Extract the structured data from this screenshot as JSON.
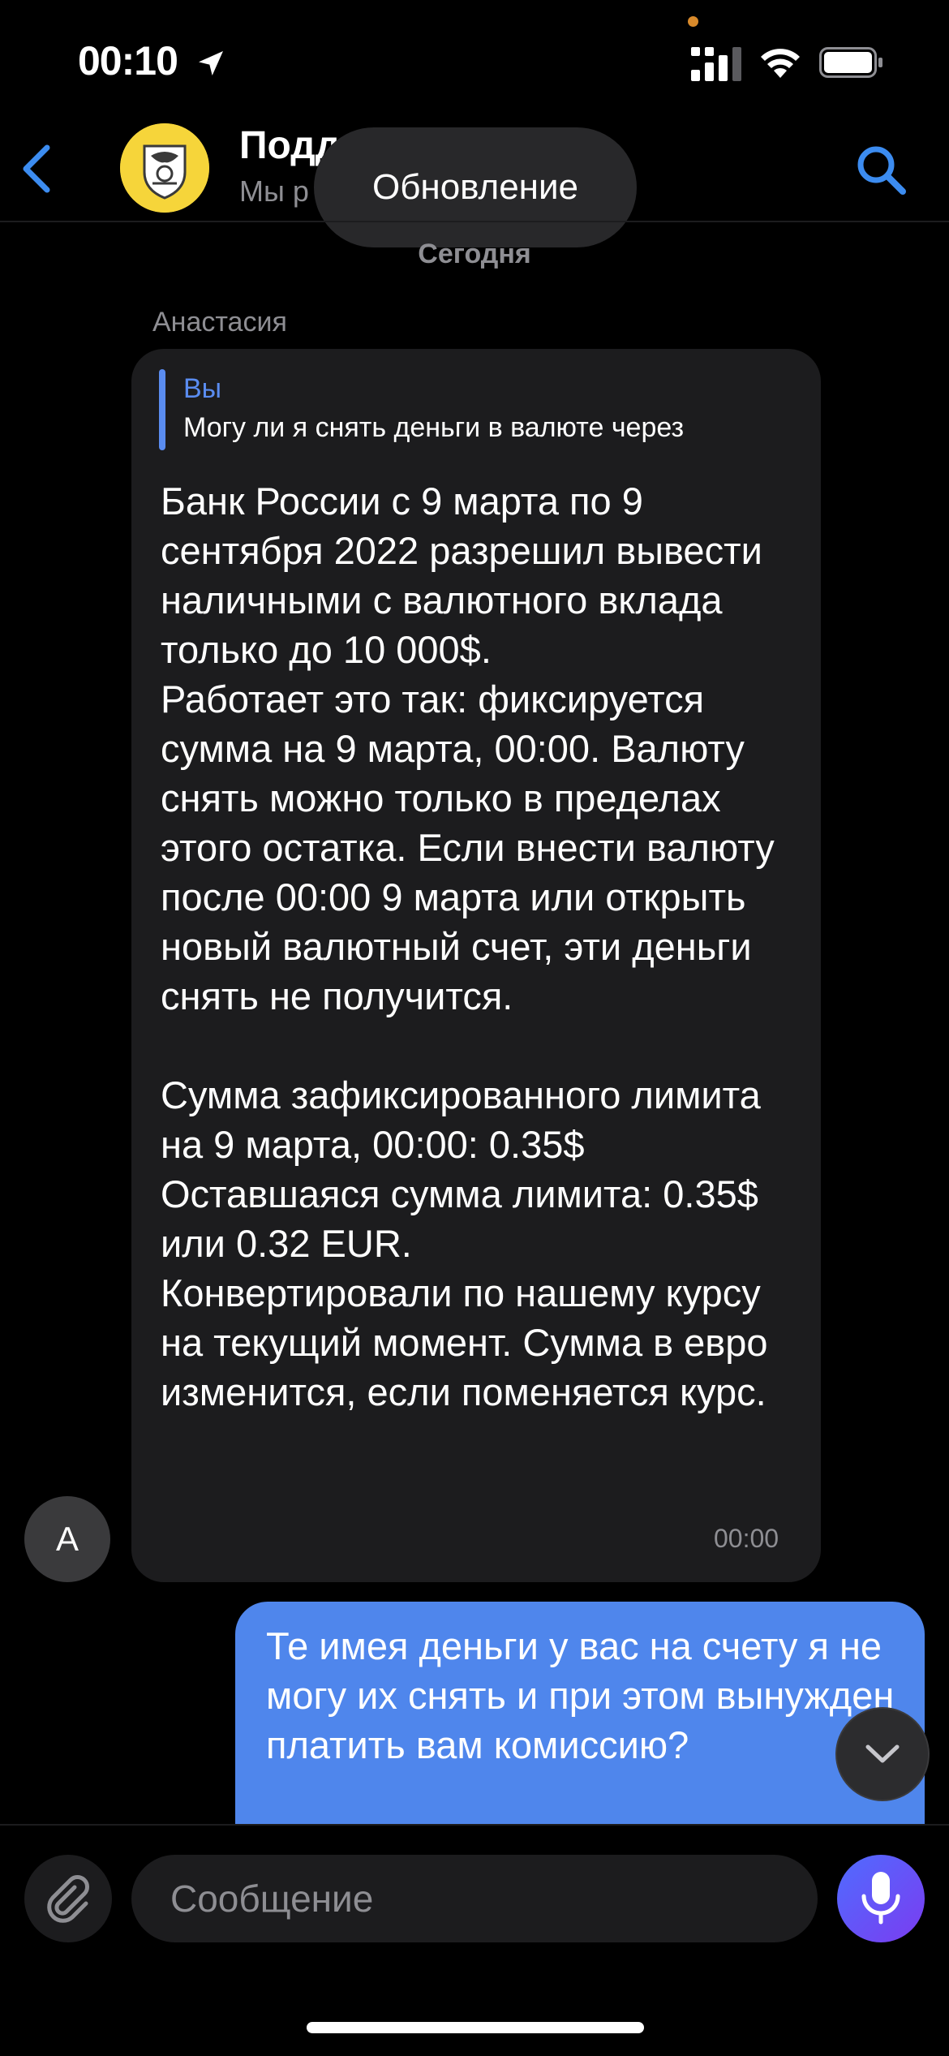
{
  "status_bar": {
    "time": "00:10"
  },
  "header": {
    "title": "Подд",
    "subtitle": "Мы р",
    "toast": "Обновление"
  },
  "chat": {
    "date_separator": "Сегодня",
    "incoming": {
      "sender": "Анастасия",
      "avatar_letter": "А",
      "reply_to": {
        "author": "Вы",
        "text": "Могу ли я снять деньги в валюте через"
      },
      "text": "Банк России с 9 марта по 9 сентября 2022 разрешил вывести наличными с валютного вклада только до 10 000$.\nРаботает это так: фиксируется сумма на 9 марта, 00:00. Валюту снять можно только в пределах этого остатка. Если внести валюту после 00:00 9 марта или открыть новый валютный счет, эти деньги снять не получится.\n\nСумма зафиксированного лимита на 9 марта, 00:00: 0.35$\nОставшаяся сумма лимита: 0.35$ или 0.32 EUR.\nКонвертировали по нашему курсу на текущий момент. Сумма в евро изменится, если поменяется курс.",
      "time": "00:00"
    },
    "outgoing": {
      "text": "Те имея деньги у вас на счету я не могу их снять и при этом вынужден платить вам комиссию?"
    }
  },
  "composer": {
    "placeholder": "Сообщение"
  },
  "colors": {
    "accent": "#4f86ec",
    "incoming_bubble": "#1c1c1e",
    "logo": "#f6d53a"
  }
}
